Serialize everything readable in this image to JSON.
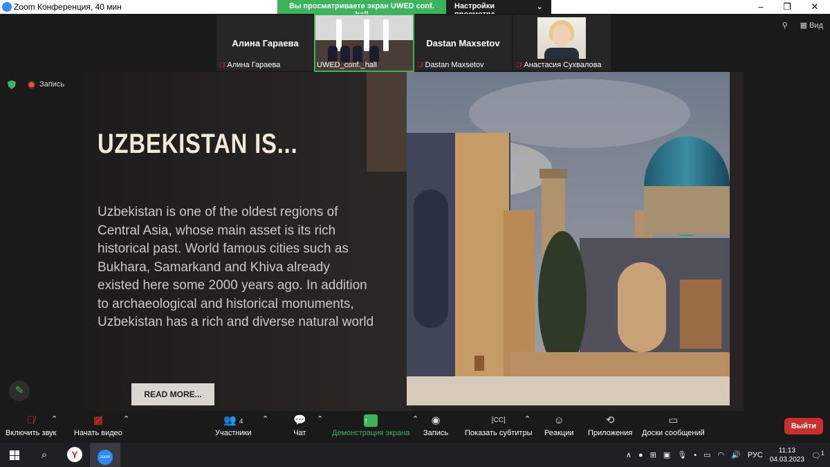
{
  "window": {
    "title": "Zoom Конференция, 40 мин",
    "share_message": "Вы просматриваете экран UWED conf. hall",
    "view_options": "Настройки просмотра"
  },
  "participants": [
    {
      "display": "Алина Гараева",
      "label": "Алина Гараева",
      "muted": true
    },
    {
      "display": "",
      "label": "UWED_conf._hall",
      "muted": false,
      "active": true
    },
    {
      "display": "Dastan Maxsetov",
      "label": "Dastan Maxsetov",
      "muted": true
    },
    {
      "display": "",
      "label": "Анастасия Сухвалова",
      "muted": true
    }
  ],
  "top_right": {
    "view_label": "Вид"
  },
  "recording": {
    "label": "Запись"
  },
  "slide": {
    "headline": "UZBEKISTAN IS...",
    "body": "Uzbekistan is one of the oldest regions of Central Asia, whose main asset is its rich historical past. World famous cities such as Bukhara, Samarkand and Khiva already existed here some 2000 years ago. In addition to archaeological and historical monuments, Uzbekistan has a rich and diverse natural world",
    "button": "READ MORE..."
  },
  "toolbar": {
    "unmute": "Включить звук",
    "start_video": "Начать видео",
    "participants": "Участники",
    "participants_count": "4",
    "chat": "Чат",
    "share_screen": "Демонстрация экрана",
    "record": "Запись",
    "captions": "Показать субтитры",
    "reactions": "Реакции",
    "apps": "Приложения",
    "whiteboards": "Доски сообщений",
    "leave": "Выйти"
  },
  "taskbar": {
    "language": "РУС",
    "time": "11:13",
    "date": "04.03.2023",
    "notifications": "1"
  },
  "colors": {
    "zoom_blue": "#2d8cff",
    "share_green": "#3bb45c",
    "leave_red": "#c9302c"
  }
}
